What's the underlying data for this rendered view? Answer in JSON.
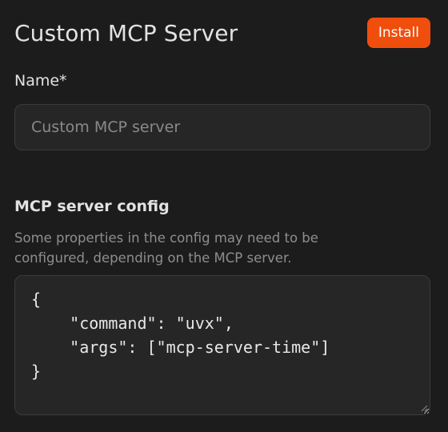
{
  "header": {
    "title": "Custom MCP Server",
    "install_label": "Install"
  },
  "form": {
    "name": {
      "label": "Name*",
      "placeholder": "Custom MCP server",
      "value": ""
    },
    "config": {
      "label": "MCP server config",
      "help": "Some properties in the config may need to be configured, depending on the MCP server.",
      "value": "{\n    \"command\": \"uvx\",\n    \"args\": [\"mcp-server-time\"]\n}"
    }
  },
  "colors": {
    "background": "#1c1c1c",
    "accent": "#f04e0c",
    "field_bg": "#262626",
    "field_border": "#3c3c3c",
    "muted_text": "#8e8e8e"
  },
  "icons": {
    "resize_grip": "resize-grip-icon"
  }
}
